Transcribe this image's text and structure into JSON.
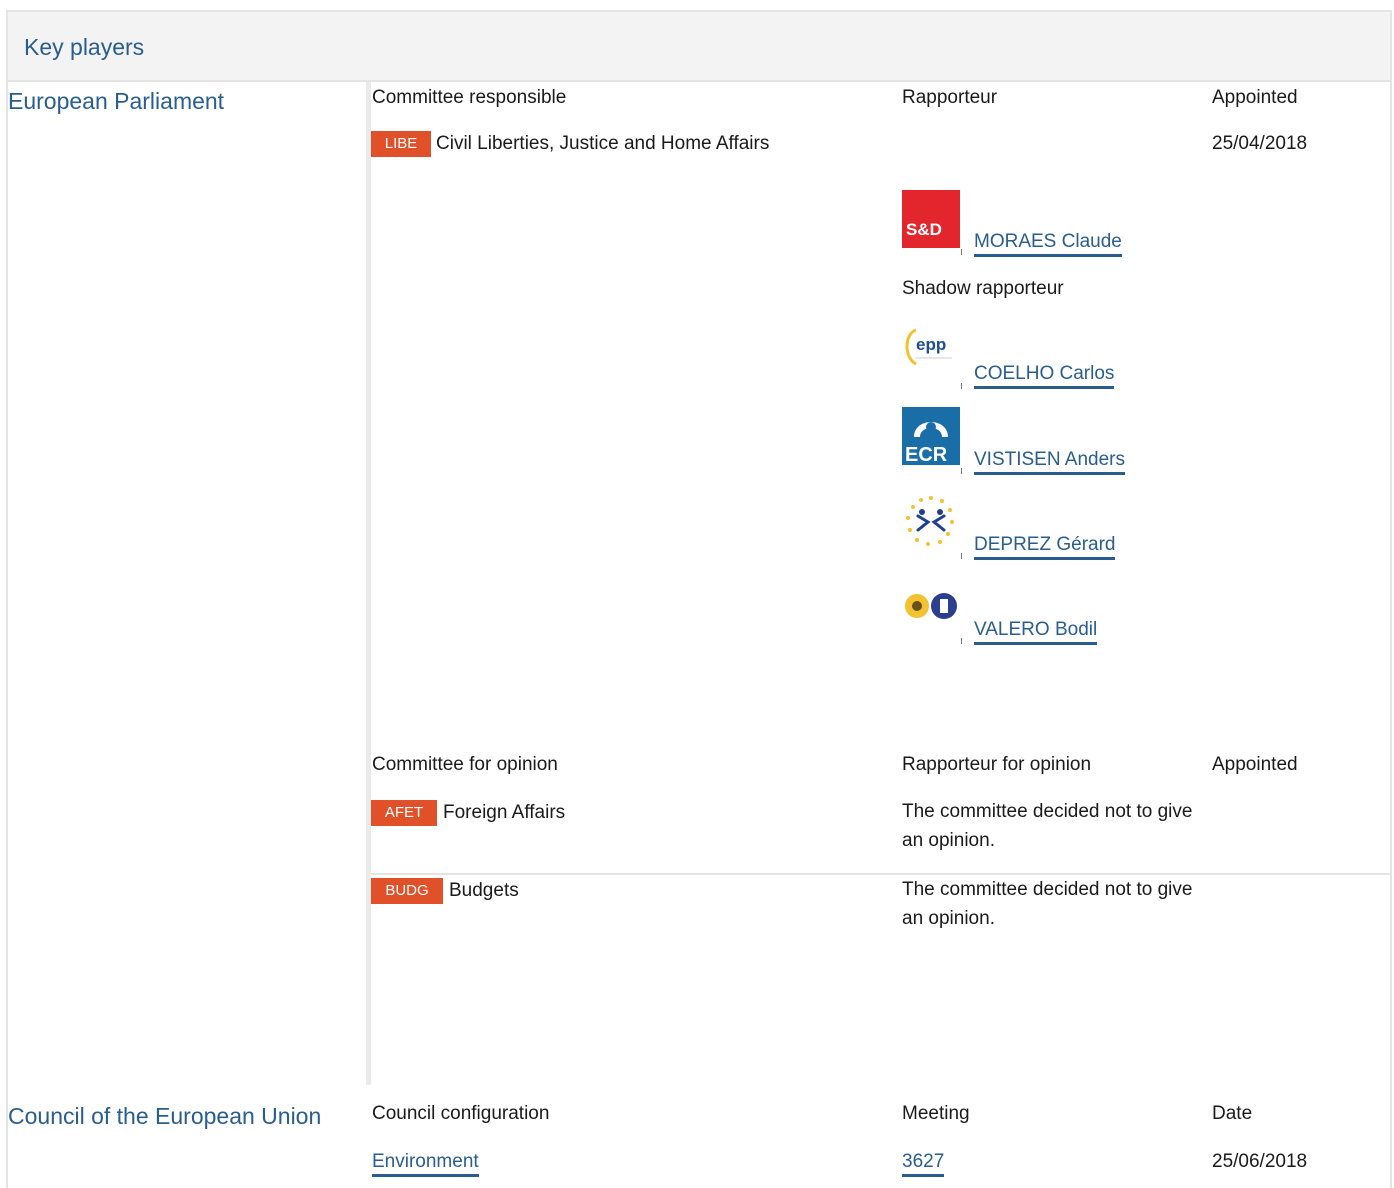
{
  "section_title": "Key players",
  "ep": {
    "label": "European Parliament",
    "responsible": {
      "col_committee": "Committee responsible",
      "col_rapporteur": "Rapporteur",
      "col_appointed": "Appointed",
      "committee": {
        "code": "LIBE",
        "name": "Civil Liberties, Justice and Home Affairs",
        "appointed": "25/04/2018"
      },
      "rapporteur": {
        "group": "S&D",
        "name": "MORAES Claude"
      },
      "shadow_label": "Shadow rapporteur",
      "shadows": [
        {
          "group_logo": "epp",
          "name": "COELHO Carlos"
        },
        {
          "group_logo": "ECR",
          "name": "VISTISEN Anders"
        },
        {
          "group_logo": "alde-stars",
          "name": "DEPREZ Gérard"
        },
        {
          "group_logo": "greens-efa",
          "name": "VALERO Bodil"
        }
      ]
    },
    "opinion": {
      "col_committee": "Committee for opinion",
      "col_rapporteur": "Rapporteur for opinion",
      "col_appointed": "Appointed",
      "committees": [
        {
          "code": "AFET",
          "name": "Foreign Affairs",
          "note": "The committee decided not to give an opinion."
        },
        {
          "code": "BUDG",
          "name": "Budgets",
          "note": "The committee decided not to give an opinion."
        }
      ]
    }
  },
  "council": {
    "label": "Council of the European Union",
    "col_config": "Council configuration",
    "col_meeting": "Meeting",
    "col_date": "Date",
    "row": {
      "config": "Environment",
      "meeting": "3627",
      "date": "25/06/2018"
    }
  },
  "colors": {
    "link": "#2a5d8f",
    "badge": "#e0512a",
    "sd_red": "#e3252d",
    "ecr_blue": "#1a6ea8"
  }
}
